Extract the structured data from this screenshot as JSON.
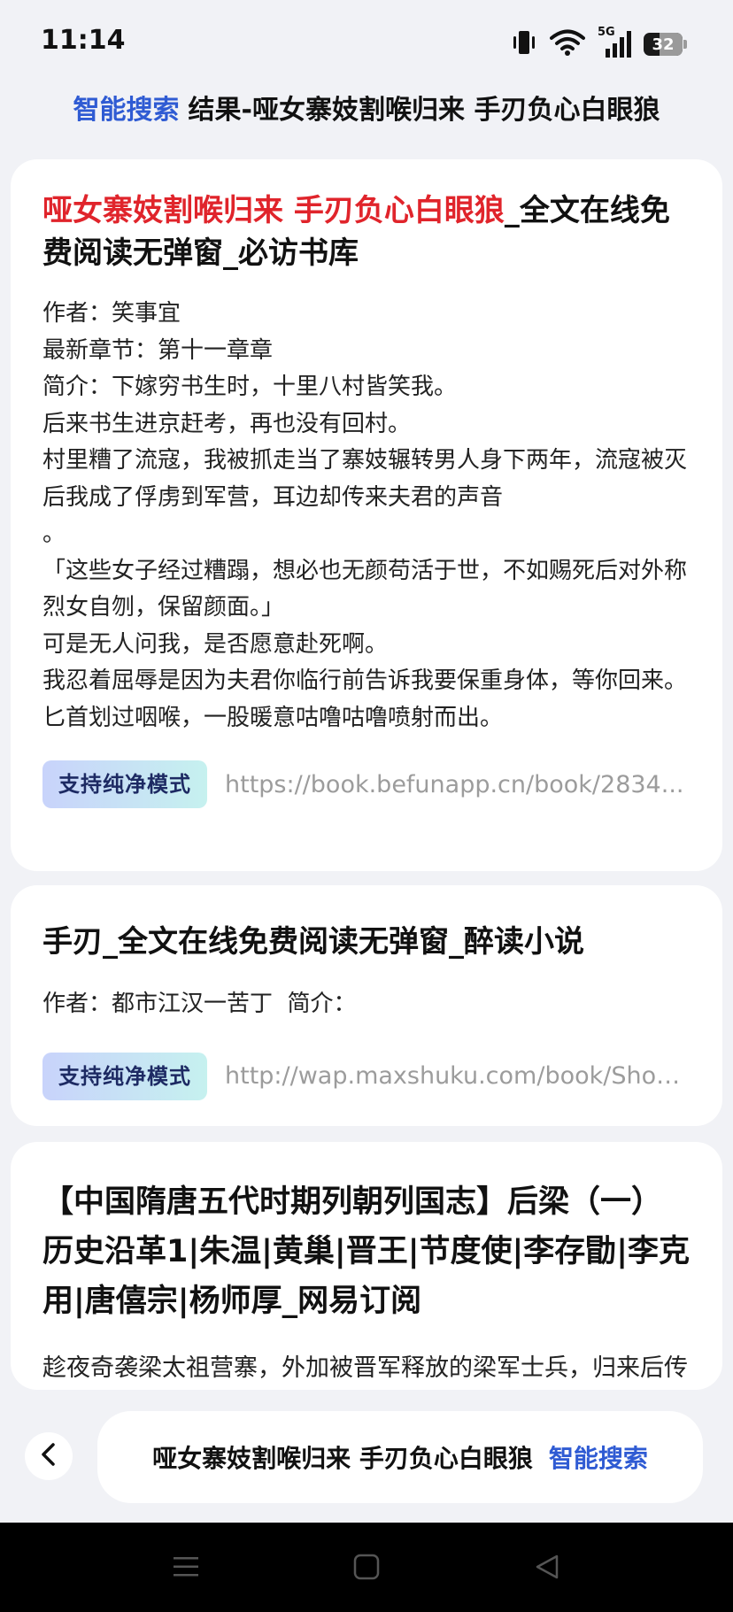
{
  "status_bar": {
    "time": "11:14",
    "network": "5G",
    "battery": "32"
  },
  "header": {
    "brand": "智能搜索",
    "title": "结果-哑女寨妓割喉归来 手刃负心白眼狼"
  },
  "results": [
    {
      "title_highlight": "哑女寨妓割喉归来 手刃负心白眼狼",
      "title_rest": "_全文在线免费阅读无弹窗_必访书库",
      "lines": [
        "作者：笑事宜",
        "最新章节：第十一章章",
        "简介：下嫁穷书生时，十里八村皆笑我。",
        "后来书生进京赶考，再也没有回村。",
        "村里糟了流寇，我被抓走当了寨妓辗转男人身下两年，流寇被灭后我成了俘虏到军营，耳边却传来夫君的声音",
        "。",
        "「这些女子经过糟蹋，想必也无颜苟活于世，不如赐死后对外称烈女自刎，保留颜面。」",
        "可是无人问我，是否愿意赴死啊。",
        "我忍着屈辱是因为夫君你临行前告诉我要保重身体，等你回来。",
        "匕首划过咽喉，一股暖意咕噜咕噜喷射而出。"
      ],
      "badge": "支持纯净模式",
      "url": "https://book.befunapp.cn/book/2834..."
    },
    {
      "title_highlight": "",
      "title_rest": "手刃_全文在线免费阅读无弹窗_醉读小说",
      "lines": [
        "作者：都市江汉一苦丁  简介："
      ],
      "badge": "支持纯净模式",
      "url": "http://wap.maxshuku.com/book/Shou..."
    },
    {
      "title_highlight": "",
      "title_rest": "【中国隋唐五代时期列朝列国志】后梁（一）历史沿革1|朱温|黄巢|晋王|节度使|李存勖|李克用|唐僖宗|杨师厚_网易订阅",
      "lines": [
        "趁夜奇袭梁太祖营寨，外加被晋军释放的梁军士兵，归来后传言李存勖亲率大军来 郢王朱友珪另是朱温的亲子"
      ]
    }
  ],
  "bottom_search": {
    "query": "哑女寨妓割喉归来 手刃负心白眼狼",
    "brand": "智能搜索"
  },
  "icons": {
    "back": "chevron-left-icon",
    "vibrate": "vibrate-icon",
    "wifi": "wifi-icon",
    "signal": "signal-icon",
    "battery": "battery-icon",
    "menu": "menu-icon",
    "home": "home-icon",
    "nav_back": "triangle-back-icon"
  },
  "colors": {
    "brand_blue": "#2f5bd3",
    "highlight_red": "#e0242b",
    "background": "#f1f2f6"
  }
}
